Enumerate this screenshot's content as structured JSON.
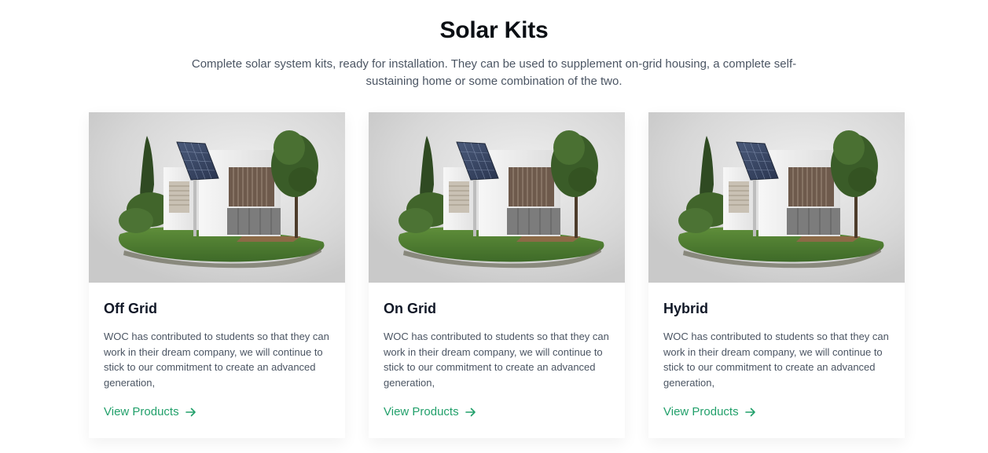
{
  "section": {
    "title": "Solar Kits",
    "subtitle": "Complete solar system kits, ready for installation. They can be used to supplement on-grid housing, a complete self-sustaining home or some combination of the two."
  },
  "cards": [
    {
      "title": "Off Grid",
      "description": "WOC has contributed to students so that they can work in their dream company, we will continue to stick to our commitment to create an advanced generation,",
      "link_label": "View Products",
      "image_icon": "solar-house-icon",
      "link_icon": "arrow-right-icon"
    },
    {
      "title": "On Grid",
      "description": "WOC has contributed to students so that they can work in their dream company, we will continue to stick to our commitment to create an advanced generation,",
      "link_label": "View Products",
      "image_icon": "solar-house-icon",
      "link_icon": "arrow-right-icon"
    },
    {
      "title": "Hybrid",
      "description": "WOC has contributed to students so that they can work in their dream company, we will continue to stick to our commitment to create an advanced generation,",
      "link_label": "View Products",
      "image_icon": "solar-house-icon",
      "link_icon": "arrow-right-icon"
    }
  ],
  "colors": {
    "accent": "#22a06b",
    "title": "#0b0f14",
    "text": "#4b5563"
  }
}
